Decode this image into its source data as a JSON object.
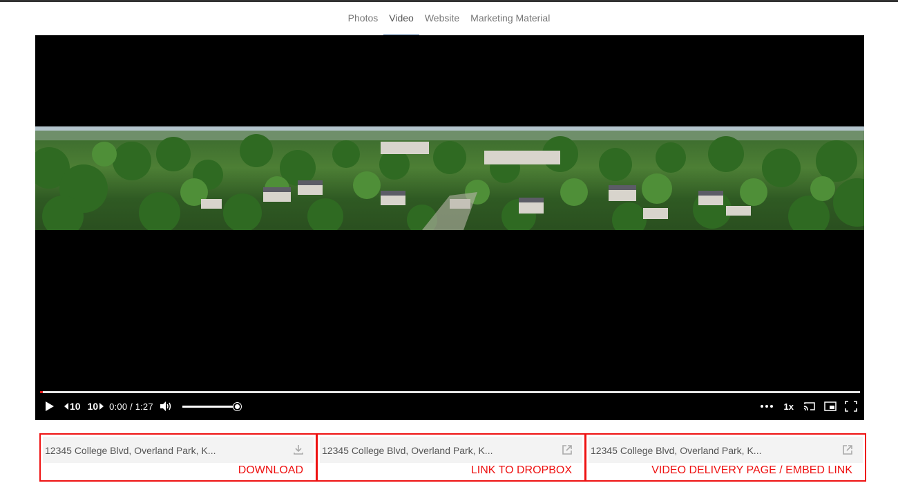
{
  "tabs": [
    {
      "label": "Photos",
      "active": false
    },
    {
      "label": "Video",
      "active": true
    },
    {
      "label": "Website",
      "active": false
    },
    {
      "label": "Marketing Material",
      "active": false
    }
  ],
  "player": {
    "skip_back_label": "10",
    "skip_forward_label": "10",
    "time_display": "0:00 / 1:27",
    "speed_label": "1x",
    "progress_fraction": 0.003,
    "volume_fraction": 1.0
  },
  "links": [
    {
      "address": "12345 College Blvd, Overland Park, K...",
      "icon": "download-icon",
      "annotation": "DOWNLOAD"
    },
    {
      "address": "12345 College Blvd, Overland Park, K...",
      "icon": "external-link-icon",
      "annotation": "LINK TO DROPBOX"
    },
    {
      "address": "12345 College Blvd, Overland Park, K...",
      "icon": "external-link-icon",
      "annotation": "VIDEO DELIVERY PAGE / EMBED LINK"
    }
  ],
  "colors": {
    "annotation_red": "#ee1111",
    "tab_active_underline": "#2e5a8a",
    "progress_red": "#e01a1a"
  }
}
